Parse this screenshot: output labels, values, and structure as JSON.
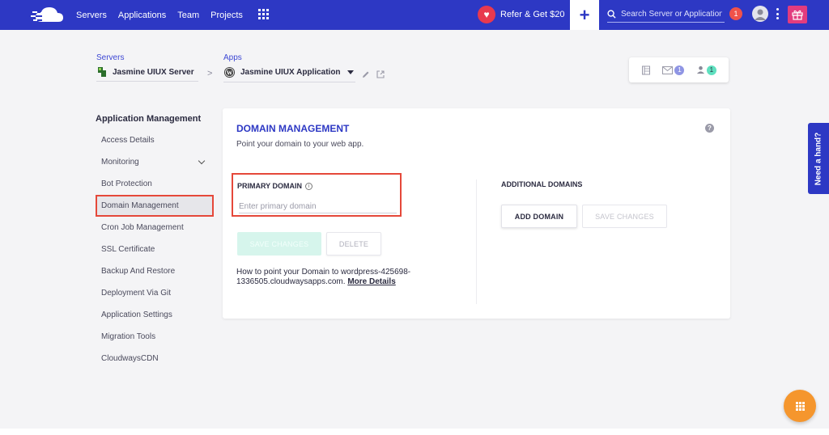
{
  "topbar": {
    "nav": [
      "Servers",
      "Applications",
      "Team",
      "Projects"
    ],
    "refer_label": "Refer & Get $20",
    "add_label": "+",
    "search_placeholder": "Search Server or Application",
    "notification_count": "1"
  },
  "breadcrumb": {
    "servers_label": "Servers",
    "server_name": "Jasmine UIUX Server",
    "separator": ">",
    "apps_label": "Apps",
    "app_name": "Jasmine UIUX Application"
  },
  "toolbox": {
    "mail_count": "1",
    "users_count": "1"
  },
  "sidebar": {
    "title": "Application Management",
    "items": [
      {
        "label": "Access Details"
      },
      {
        "label": "Monitoring"
      },
      {
        "label": "Bot Protection"
      },
      {
        "label": "Domain Management"
      },
      {
        "label": "Cron Job Management"
      },
      {
        "label": "SSL Certificate"
      },
      {
        "label": "Backup And Restore"
      },
      {
        "label": "Deployment Via Git"
      },
      {
        "label": "Application Settings"
      },
      {
        "label": "Migration Tools"
      },
      {
        "label": "CloudwaysCDN"
      }
    ],
    "active_index": 3
  },
  "card": {
    "title": "DOMAIN MANAGEMENT",
    "subtitle": "Point your domain to your web app.",
    "help": "?",
    "primary_label": "PRIMARY DOMAIN",
    "primary_placeholder": "Enter primary domain",
    "save_label": "SAVE CHANGES",
    "delete_label": "DELETE",
    "howto_text": "How to point your Domain to wordpress-425698-1336505.cloudwaysapps.com.",
    "howto_link": "More Details",
    "additional_title": "ADDITIONAL DOMAINS",
    "add_domain_label": "ADD DOMAIN",
    "save2_label": "SAVE CHANGES"
  },
  "need_hand": "Need a hand?",
  "colors": {
    "brand": "#2d38c4",
    "highlight": "#e5483a",
    "fab": "#f5962d"
  }
}
